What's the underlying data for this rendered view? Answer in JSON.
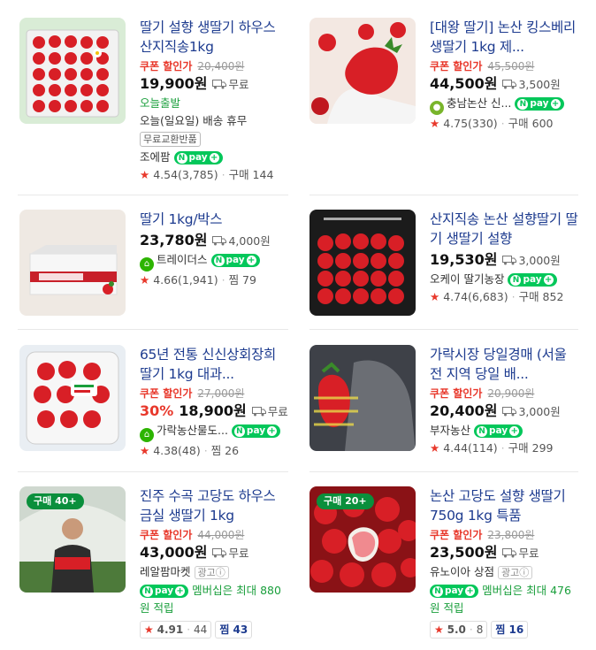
{
  "products": [
    {
      "title": "딸기 설향 생딸기 하우스 산지직송1kg",
      "coupon": "쿠폰 할인가",
      "orig": "20,400원",
      "price": "19,900원",
      "ship": "무료",
      "lines": [
        "오늘출발",
        "오늘(일요일) 배송 휴무"
      ],
      "tag": "무료교환반품",
      "shop": "조에팜",
      "rating": "4.54",
      "reviews": "(3,785)",
      "meta": "구매 144"
    },
    {
      "title": "[대왕 딸기] 논산 킹스베리 생딸기 1kg 제...",
      "coupon": "쿠폰 할인가",
      "orig": "45,500원",
      "price": "44,500원",
      "ship": "3,500원",
      "shop": "충남논산 신...",
      "rating": "4.75",
      "reviews": "(330)",
      "meta": "구매 600"
    },
    {
      "title": "딸기 1kg/박스",
      "price": "23,780원",
      "ship": "4,000원",
      "shop": "트레이더스",
      "rating": "4.66",
      "reviews": "(1,941)",
      "meta": "찜 79"
    },
    {
      "title": "산지직송 논산 설향딸기 딸기 생딸기 설향",
      "price": "19,530원",
      "ship": "3,000원",
      "shop": "오케이 딸기농장",
      "rating": "4.74",
      "reviews": "(6,683)",
      "meta": "구매 852"
    },
    {
      "title": "65년 전통 신신상회장희 딸기 1kg 대과...",
      "coupon": "쿠폰 할인가",
      "orig": "27,000원",
      "discount": "30%",
      "price": "18,900원",
      "ship": "무료",
      "shop": "가락농산물도...",
      "rating": "4.38",
      "reviews": "(48)",
      "meta": "찜 26"
    },
    {
      "title": "가락시장 당일경매 (서울 전 지역 당일 배...",
      "coupon": "쿠폰 할인가",
      "orig": "20,900원",
      "price": "20,400원",
      "ship": "3,000원",
      "shop": "부자농산",
      "rating": "4.44",
      "reviews": "(114)",
      "meta": "구매 299"
    },
    {
      "badge": "구매 40+",
      "title": "진주 수곡 고당도 하우스 금실 생딸기 1kg",
      "coupon": "쿠폰 할인가",
      "orig": "44,000원",
      "price": "43,000원",
      "ship": "무료",
      "shop": "레알팜마켓",
      "ad": "광고ⓘ",
      "membership": "멤버십은 최대 880원 적립",
      "rating": "4.91",
      "reviews": "44",
      "meta": "찜 43"
    },
    {
      "badge": "구매 20+",
      "title": "논산 고당도 설향 생딸기 750g 1kg 특품",
      "coupon": "쿠폰 할인가",
      "orig": "23,800원",
      "price": "23,500원",
      "ship": "무료",
      "shop": "유노이아 상점",
      "ad": "광고ⓘ",
      "membership": "멤버십은 최대 476원 적립",
      "rating": "5.0",
      "reviews": "8",
      "meta": "찜 16"
    }
  ],
  "npay_label": "pay",
  "npay_n": "N",
  "star_glyph": "★",
  "colors": {
    "title": "#1d3b8f",
    "coupon": "#e8382b",
    "npay": "#03c75a",
    "badge": "#0a8f3c"
  }
}
